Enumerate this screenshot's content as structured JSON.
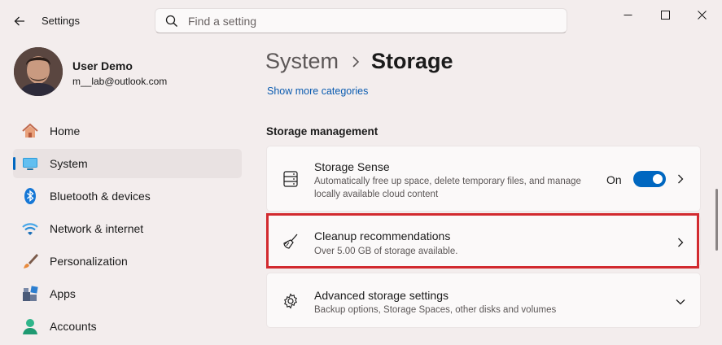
{
  "window": {
    "title": "Settings",
    "search_placeholder": "Find a setting"
  },
  "user": {
    "name": "User Demo",
    "email": "m__lab@outlook.com"
  },
  "nav": {
    "items": [
      {
        "label": "Home",
        "icon": "home-icon"
      },
      {
        "label": "System",
        "icon": "monitor-icon",
        "active": true
      },
      {
        "label": "Bluetooth & devices",
        "icon": "bluetooth-icon"
      },
      {
        "label": "Network & internet",
        "icon": "wifi-icon"
      },
      {
        "label": "Personalization",
        "icon": "brush-icon"
      },
      {
        "label": "Apps",
        "icon": "apps-icon"
      },
      {
        "label": "Accounts",
        "icon": "person-icon"
      }
    ]
  },
  "main": {
    "breadcrumb_parent": "System",
    "breadcrumb_current": "Storage",
    "more_link": "Show more categories",
    "section_title": "Storage management",
    "cards": [
      {
        "title": "Storage Sense",
        "desc": "Automatically free up space, delete temporary files, and manage locally available cloud content",
        "toggle_label": "On",
        "toggle_on": true,
        "icon": "storage-drive-icon"
      },
      {
        "title": "Cleanup recommendations",
        "desc": "Over 5.00 GB of storage available.",
        "icon": "broom-icon",
        "highlighted": true
      },
      {
        "title": "Advanced storage settings",
        "desc": "Backup options, Storage Spaces, other disks and volumes",
        "icon": "gear-icon"
      }
    ]
  },
  "colors": {
    "accent": "#0067c0",
    "highlight": "#d22a2f",
    "background": "#f3eded"
  }
}
